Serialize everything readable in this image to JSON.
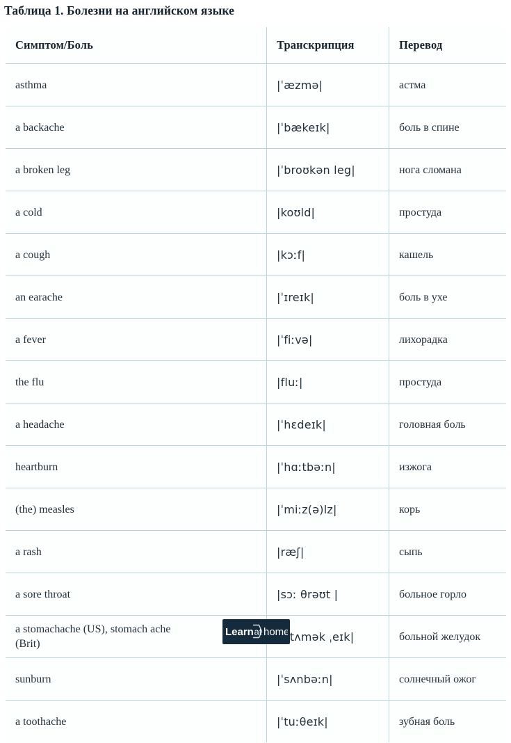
{
  "title": "Таблица 1. Болезни на английском языке",
  "table": {
    "headers": {
      "term": "Симптом/Боль",
      "transcription": "Транскрипция",
      "translation": "Перевод"
    },
    "rows": [
      {
        "term": "asthma",
        "term2": "",
        "ipa": "|ˈæzmə|",
        "translation": "астма"
      },
      {
        "term": "a backache",
        "term2": "",
        "ipa": "|ˈbækeɪk|",
        "translation": "боль в спине"
      },
      {
        "term": "a broken leg",
        "term2": "",
        "ipa": "|ˈbroʊkən leg|",
        "translation": "нога сломана"
      },
      {
        "term": "a cold",
        "term2": "",
        "ipa": "|koʊld|",
        "translation": "простуда"
      },
      {
        "term": "a cough",
        "term2": "",
        "ipa": "|kɔːf|",
        "translation": "кашель"
      },
      {
        "term": "an earache",
        "term2": "",
        "ipa": "|ˈɪreɪk|",
        "translation": "боль в ухе"
      },
      {
        "term": "a fever",
        "term2": "",
        "ipa": "|ˈfiːvə|",
        "translation": "лихорадка"
      },
      {
        "term": "the flu",
        "term2": "",
        "ipa": "|fluː|",
        "translation": "простуда"
      },
      {
        "term": "a headache",
        "term2": "",
        "ipa": "|ˈhɛdeɪk|",
        "translation": "головная боль"
      },
      {
        "term": "heartburn",
        "term2": "",
        "ipa": "|ˈhɑːtbəːn|",
        "translation": "изжога"
      },
      {
        "term": "(the) measles",
        "term2": "",
        "ipa": "|ˈmiːz(ə)lz|",
        "translation": "корь"
      },
      {
        "term": "a rash",
        "term2": "",
        "ipa": "|ræʃ|",
        "translation": "сыпь"
      },
      {
        "term": "a sore throat",
        "term2": "",
        "ipa": "|sɔː θrəʊt |",
        "translation": "больное горло"
      },
      {
        "term": "a stomachache (US), stomach ache",
        "term2": "(Brit)",
        "ipa": "|ˈstʌmək ˌeɪk|",
        "translation": "больной желудок"
      },
      {
        "term": "sunburn",
        "term2": "",
        "ipa": "|ˈsʌnbəːn|",
        "translation": "солнечный ожог"
      },
      {
        "term": "a toothache",
        "term2": "",
        "ipa": "|ˈtuːθeɪk|",
        "translation": "зубная боль"
      }
    ]
  },
  "logo": {
    "word1": "Learn",
    "word2": "at",
    "word3": "home"
  },
  "colors": {
    "page_background": "#ffffff",
    "table_background": "#fdfefe",
    "border": "#b9d5da",
    "outer_border": "#cfe0e4",
    "text": "#24323c",
    "heading_text": "#16242e",
    "logo_background": "#152b3b",
    "logo_text": "#ffffff"
  }
}
